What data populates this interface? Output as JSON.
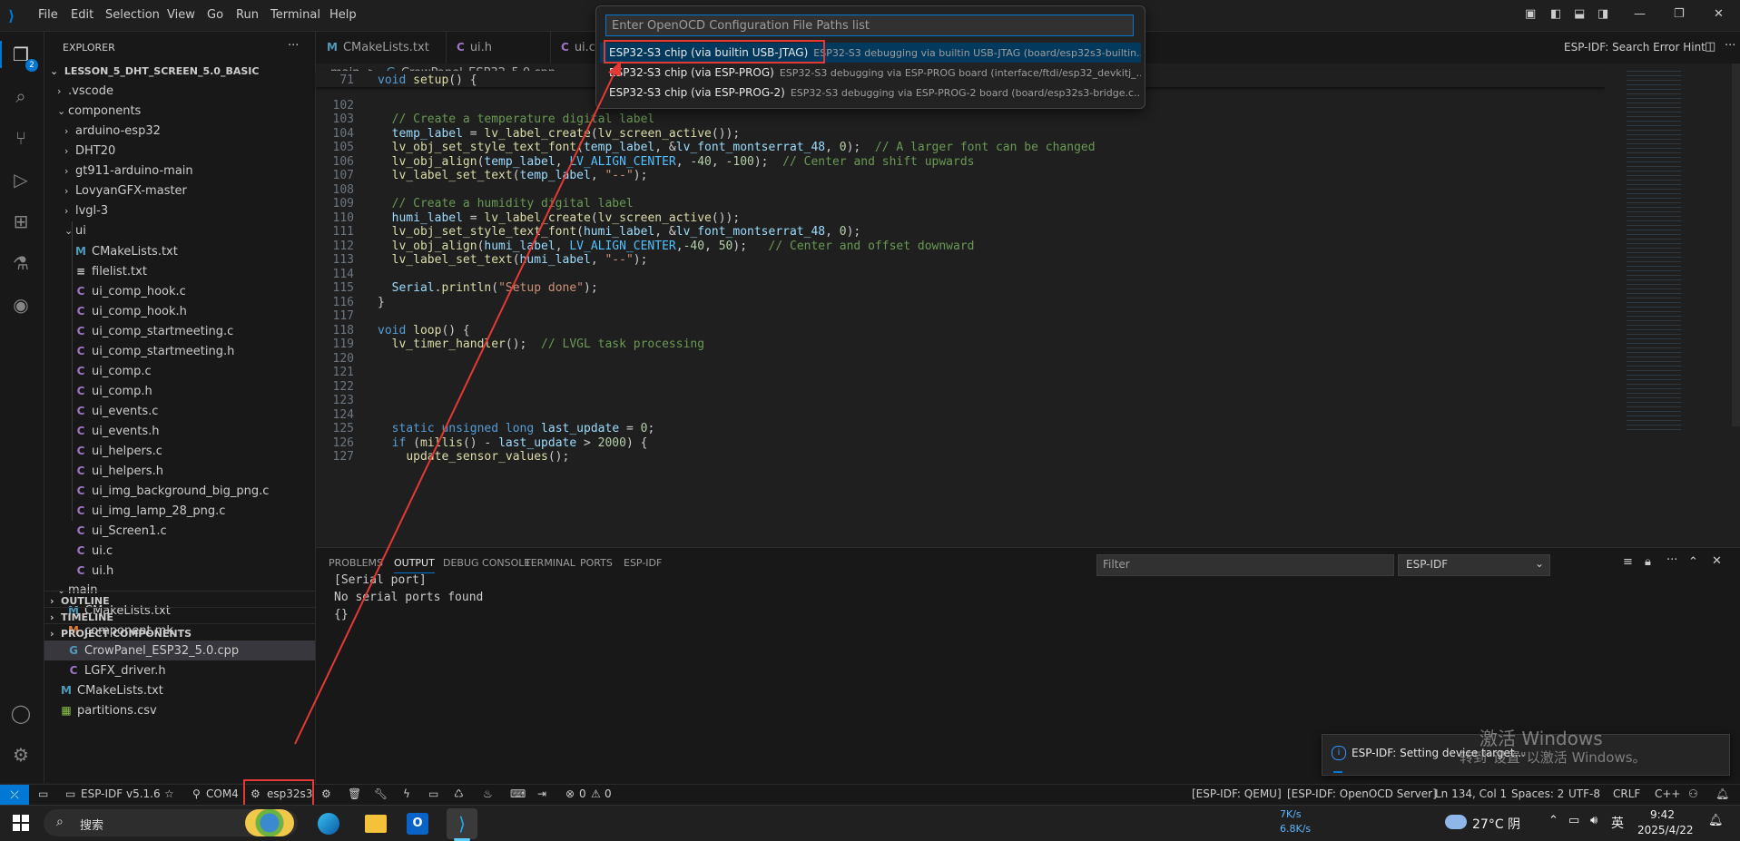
{
  "menu": [
    "File",
    "Edit",
    "Selection",
    "View",
    "Go",
    "Run",
    "Terminal",
    "Help"
  ],
  "sidebar": {
    "title": "EXPLORER",
    "more": "···",
    "root": "LESSON_5_DHT_SCREEN_5.0_BASIC",
    "rows": [
      {
        "label": ".vscode",
        "type": "folder",
        "depth": 1,
        "open": false
      },
      {
        "label": "components",
        "type": "folder",
        "depth": 1,
        "open": true
      },
      {
        "label": "arduino-esp32",
        "type": "folder",
        "depth": 2,
        "open": false
      },
      {
        "label": "DHT20",
        "type": "folder",
        "depth": 2,
        "open": false
      },
      {
        "label": "gt911-arduino-main",
        "type": "folder",
        "depth": 2,
        "open": false
      },
      {
        "label": "LovyanGFX-master",
        "type": "folder",
        "depth": 2,
        "open": false
      },
      {
        "label": "lvgl-3",
        "type": "folder",
        "depth": 2,
        "open": false
      },
      {
        "label": "ui",
        "type": "folder",
        "depth": 2,
        "open": true
      },
      {
        "label": "CMakeLists.txt",
        "type": "M",
        "depth": 3
      },
      {
        "label": "filelist.txt",
        "type": "txt",
        "depth": 3
      },
      {
        "label": "ui_comp_hook.c",
        "type": "C",
        "depth": 3
      },
      {
        "label": "ui_comp_hook.h",
        "type": "C",
        "depth": 3
      },
      {
        "label": "ui_comp_startmeeting.c",
        "type": "C",
        "depth": 3
      },
      {
        "label": "ui_comp_startmeeting.h",
        "type": "C",
        "depth": 3
      },
      {
        "label": "ui_comp.c",
        "type": "C",
        "depth": 3
      },
      {
        "label": "ui_comp.h",
        "type": "C",
        "depth": 3
      },
      {
        "label": "ui_events.c",
        "type": "C",
        "depth": 3
      },
      {
        "label": "ui_events.h",
        "type": "C",
        "depth": 3
      },
      {
        "label": "ui_helpers.c",
        "type": "C",
        "depth": 3
      },
      {
        "label": "ui_helpers.h",
        "type": "C",
        "depth": 3
      },
      {
        "label": "ui_img_background_big_png.c",
        "type": "C",
        "depth": 3
      },
      {
        "label": "ui_img_lamp_28_png.c",
        "type": "C",
        "depth": 3
      },
      {
        "label": "ui_Screen1.c",
        "type": "C",
        "depth": 3
      },
      {
        "label": "ui.c",
        "type": "C",
        "depth": 3
      },
      {
        "label": "ui.h",
        "type": "C",
        "depth": 3
      },
      {
        "label": "main",
        "type": "folder",
        "depth": 1,
        "open": true
      },
      {
        "label": "CMakeLists.txt",
        "type": "M",
        "depth": 2
      },
      {
        "label": "component.mk",
        "type": "mk",
        "depth": 2
      },
      {
        "label": "CrowPanel_ESP32_5.0.cpp",
        "type": "cpp",
        "depth": 2,
        "selected": true
      },
      {
        "label": "LGFX_driver.h",
        "type": "C",
        "depth": 2
      },
      {
        "label": "CMakeLists.txt",
        "type": "M",
        "depth": 1
      },
      {
        "label": "partitions.csv",
        "type": "csv",
        "depth": 1
      }
    ],
    "sections": [
      "OUTLINE",
      "TIMELINE",
      "PROJECT COMPONENTS"
    ]
  },
  "tabs": [
    "CMakeLists.txt",
    "ui.h",
    "ui.c"
  ],
  "editor_actions_label": "ESP-IDF: Search Error Hint",
  "breadcrumb": {
    "folder": "main",
    "sep": ">",
    "file": "CrowPanel_ESP32_5.0.cpp"
  },
  "code": [
    {
      "n": "71",
      "t": "void setup() {"
    },
    {
      "n": "102",
      "t": ""
    },
    {
      "n": "103",
      "t": "  // Create a temperature digital label"
    },
    {
      "n": "104",
      "t": "  temp_label = lv_label_create(lv_screen_active());"
    },
    {
      "n": "105",
      "t": "  lv_obj_set_style_text_font(temp_label, &lv_font_montserrat_48, 0);  // A larger font can be changed"
    },
    {
      "n": "106",
      "t": "  lv_obj_align(temp_label, LV_ALIGN_CENTER, -40, -100);  // Center and shift upwards"
    },
    {
      "n": "107",
      "t": "  lv_label_set_text(temp_label, \"--\");"
    },
    {
      "n": "108",
      "t": ""
    },
    {
      "n": "109",
      "t": "  // Create a humidity digital label"
    },
    {
      "n": "110",
      "t": "  humi_label = lv_label_create(lv_screen_active());"
    },
    {
      "n": "111",
      "t": "  lv_obj_set_style_text_font(humi_label, &lv_font_montserrat_48, 0);"
    },
    {
      "n": "112",
      "t": "  lv_obj_align(humi_label, LV_ALIGN_CENTER,-40, 50);   // Center and offset downward"
    },
    {
      "n": "113",
      "t": "  lv_label_set_text(humi_label, \"--\");"
    },
    {
      "n": "114",
      "t": ""
    },
    {
      "n": "115",
      "t": "  Serial.println(\"Setup done\");"
    },
    {
      "n": "116",
      "t": "}"
    },
    {
      "n": "117",
      "t": ""
    },
    {
      "n": "118",
      "t": "void loop() {"
    },
    {
      "n": "119",
      "t": "  lv_timer_handler();  // LVGL task processing"
    },
    {
      "n": "120",
      "t": ""
    },
    {
      "n": "121",
      "t": ""
    },
    {
      "n": "122",
      "t": ""
    },
    {
      "n": "123",
      "t": ""
    },
    {
      "n": "124",
      "t": ""
    },
    {
      "n": "125",
      "t": "  static unsigned long last_update = 0;"
    },
    {
      "n": "126",
      "t": "  if (millis() - last_update > 2000) {"
    },
    {
      "n": "127",
      "t": "    update_sensor_values();"
    }
  ],
  "quickpick": {
    "placeholder": "Enter OpenOCD Configuration File Paths list",
    "items": [
      {
        "label": "ESP32-S3 chip (via builtin USB-JTAG)",
        "desc": "ESP32-S3 debugging via builtin USB-JTAG (board/esp32s3-builtin..."
      },
      {
        "label": "ESP32-S3 chip (via ESP-PROG)",
        "desc": "ESP32-S3 debugging via ESP-PROG board (interface/ftdi/esp32_devkitj_..."
      },
      {
        "label": "ESP32-S3 chip (via ESP-PROG-2)",
        "desc": "ESP32-S3 debugging via ESP-PROG-2 board (board/esp32s3-bridge.c..."
      }
    ]
  },
  "panel": {
    "tabs": [
      "PROBLEMS",
      "OUTPUT",
      "DEBUG CONSOLE",
      "TERMINAL",
      "PORTS",
      "ESP-IDF"
    ],
    "active_tab": "OUTPUT",
    "filter_placeholder": "Filter",
    "channel": "ESP-IDF",
    "output": [
      "[Serial port]",
      "No serial ports found",
      "{}"
    ]
  },
  "notification": {
    "text": "ESP-IDF: Setting device target..."
  },
  "watermark": {
    "line1": "激活 Windows",
    "line2": "转到\"设置\"以激活 Windows。"
  },
  "statusbar": {
    "idf_version": "ESP-IDF v5.1.6",
    "port": "COM4",
    "target": "esp32s3",
    "problems": "0",
    "warnings": "0",
    "qemu": "[ESP-IDF: QEMU]",
    "openocd": "[ESP-IDF: OpenOCD Server]",
    "position": "Ln 134, Col 1",
    "spaces": "Spaces: 2",
    "encoding": "UTF-8",
    "eol": "CRLF",
    "lang": "C++"
  },
  "taskbar": {
    "search": "搜索",
    "net_up": "7K/s",
    "net_down": "6.8K/s",
    "weather": "27°C 阴",
    "ime": "英",
    "time": "9:42",
    "date": "2025/4/22"
  },
  "colors": {
    "accent": "#0078d4",
    "highlight": "#e53935",
    "selection": "#04395e",
    "statusbar": "#181818"
  }
}
